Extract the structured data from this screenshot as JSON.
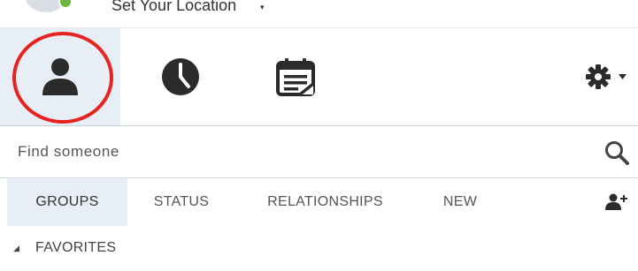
{
  "location": {
    "label": "Set Your Location",
    "caret": "▾"
  },
  "toolbar": {
    "tabs": [
      {
        "name": "contacts",
        "icon": "contacts-person-icon",
        "selected": true
      },
      {
        "name": "recent",
        "icon": "clock-icon",
        "selected": false
      },
      {
        "name": "meetings",
        "icon": "calendar-meeting-icon",
        "selected": false
      }
    ],
    "settings_icon": "gear-icon",
    "highlight_color": "#e8231f"
  },
  "search": {
    "placeholder": "Find someone",
    "icon": "search-icon"
  },
  "filters": {
    "tabs": [
      {
        "label": "GROUPS",
        "active": true
      },
      {
        "label": "STATUS",
        "active": false
      },
      {
        "label": "RELATIONSHIPS",
        "active": false
      },
      {
        "label": "NEW",
        "active": false
      }
    ],
    "add_icon": "add-contact-icon"
  },
  "groups": {
    "favorites_label": "FAVORITES",
    "caret": "◢"
  },
  "colors": {
    "accent_bg": "#e8eef5",
    "icon_dark": "#2b2b2b",
    "presence_available": "#6ab73c"
  }
}
